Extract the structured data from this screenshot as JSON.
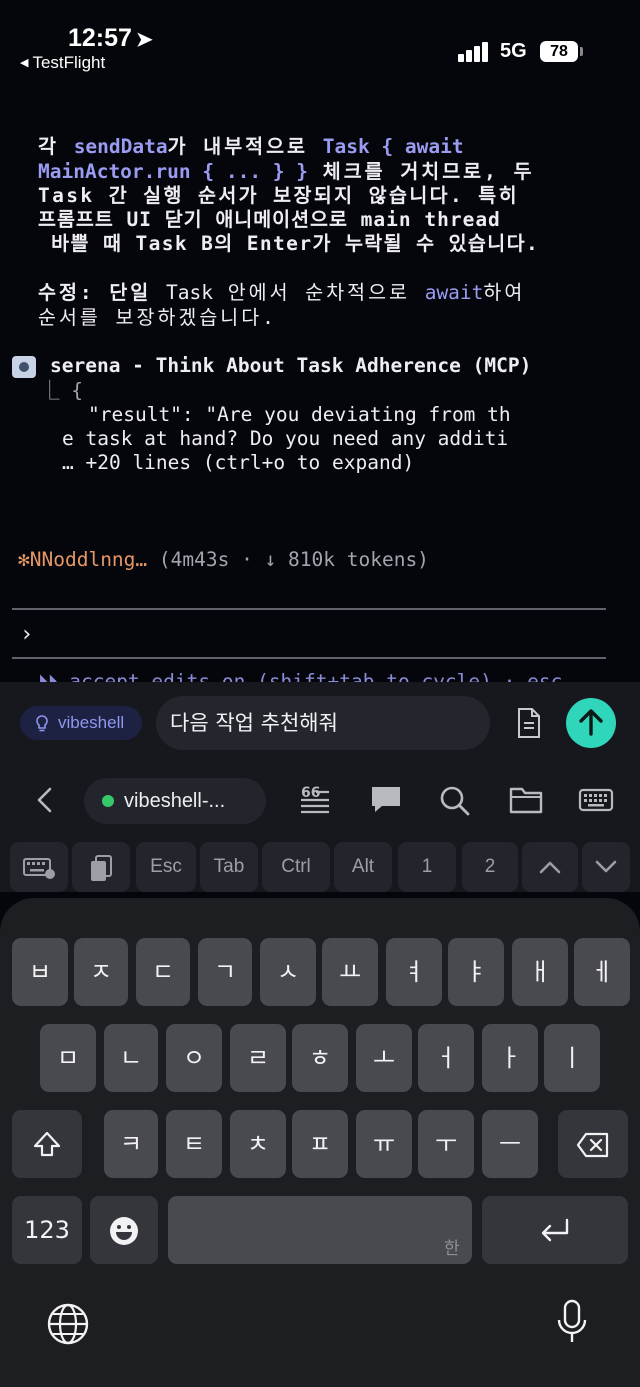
{
  "status_bar": {
    "time": "12:57",
    "back_app": "TestFlight",
    "network": "5G",
    "battery": "78"
  },
  "terminal": {
    "lines": [
      [
        "각 ",
        "sendData",
        "가 내부적으로 ",
        "Task { await"
      ],
      [
        "MainActor.run { ... } }",
        " 체크를 거치므로, 두"
      ],
      [
        "Task 간 실행 순서가 보장되지 않습니다. 특히"
      ],
      [
        "프롬프트 UI 닫기 애니메이션으로 main thread"
      ],
      [
        " 바쁠 때 Task B의 Enter가 누락될 수 있습니다."
      ],
      [
        "수정: 단일 ",
        "Task",
        " 안에서 순차적으로 ",
        "await",
        "하여"
      ],
      [
        "순서를 보장하겠습니다."
      ]
    ],
    "tool_call": "serena - Think About Task Adherence (MCP)",
    "result_open": "⎿ {",
    "result_lines": [
      "\"result\": \"Are you deviating from th",
      "e task at hand? Do you need any additi",
      "… +20 lines (ctrl+o to expand)"
    ],
    "status": {
      "spinner": "✻",
      "word": "NNoddlnng…",
      "detail": "(4m43s · ↓ 810k tokens)"
    },
    "prompt_symbol": "›",
    "cut_hint": "⏵⏵ accept edits on (shift+tab to cycle) · esc"
  },
  "input": {
    "app_chip": "vibeshell",
    "message": "다음 작업 추천해줘",
    "session": "vibeshell-...",
    "keys": [
      "Esc",
      "Tab",
      "Ctrl",
      "Alt",
      "1",
      "2"
    ]
  },
  "keyboard": {
    "row1": [
      "ㅂ",
      "ㅈ",
      "ㄷ",
      "ㄱ",
      "ㅅ",
      "ㅛ",
      "ㅕ",
      "ㅑ",
      "ㅐ",
      "ㅔ"
    ],
    "row2": [
      "ㅁ",
      "ㄴ",
      "ㅇ",
      "ㄹ",
      "ㅎ",
      "ㅗ",
      "ㅓ",
      "ㅏ",
      "ㅣ"
    ],
    "row3": [
      "ㅋ",
      "ㅌ",
      "ㅊ",
      "ㅍ",
      "ㅠ",
      "ㅜ",
      "ㅡ"
    ],
    "numbers": "123",
    "space_hint": "한"
  },
  "colors": {
    "accent": "#2fd6b9",
    "highlight": "#9a9cf2",
    "spinner": "#e59766",
    "session_dot": "#36c96a"
  },
  "icons": [
    "location-arrow-icon",
    "signal-icon",
    "lightbulb-icon",
    "document-icon",
    "send-arrow-icon",
    "chevron-left-icon",
    "list-quote-icon",
    "chat-bubble-icon",
    "search-icon",
    "folder-icon",
    "keyboard-icon",
    "keyboard-settings-icon",
    "clipboard-icon",
    "chevron-up-icon",
    "chevron-down-icon",
    "shift-icon",
    "backspace-icon",
    "emoji-icon",
    "return-icon",
    "globe-icon",
    "microphone-icon"
  ]
}
